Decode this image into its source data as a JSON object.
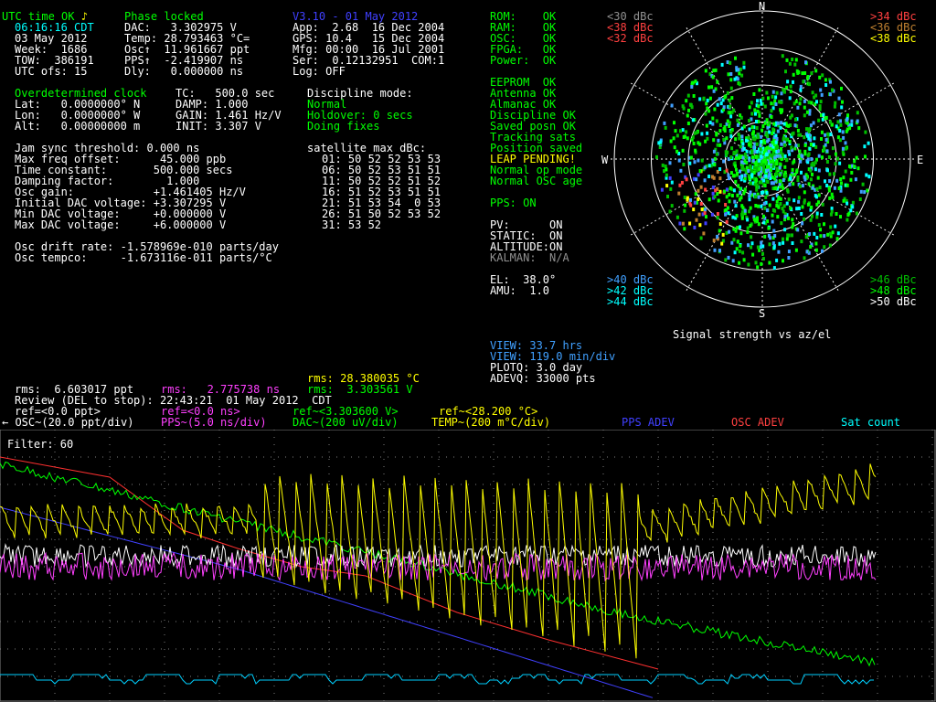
{
  "status": {
    "utc_ok": "UTC time OK",
    "note_icon": "♪",
    "phase": "Phase locked",
    "version": "V3.10 - 01 May 2012",
    "time": "06:16:16 CDT",
    "date": "03 May 2012",
    "week": "Week:  1686",
    "tow": "TOW:  386191",
    "utc_ofs": "UTC ofs: 15"
  },
  "col2": {
    "dac": "DAC:   3.302975 V",
    "temp": "Temp: 28.793463 °C=",
    "osc": "Osc↑  11.961667 ppt",
    "pps": "PPS↑  -2.419907 ns",
    "dly": "Dly:   0.000000 ns"
  },
  "col3": {
    "app": "App:  2.68  16 Dec 2004",
    "gps": "GPS: 10.4   15 Dec 2004",
    "mfg": "Mfg: 00:00  16 Jul 2001",
    "ser": "Ser:  0.12132951  COM:1",
    "log": "Log: OFF"
  },
  "health": {
    "rom": "ROM:    OK",
    "ram": "RAM:    OK",
    "osc": "OSC:    OK",
    "fpga": "FPGA:   OK",
    "power": "Power:  OK",
    "eeprom": "EEPROM  OK",
    "antenna": "Antenna OK",
    "almanac": "Almanac OK",
    "discipline": "Discipline OK",
    "saved_posn": "Saved posn OK",
    "tracking": "Tracking sats",
    "position_saved": "Position saved",
    "leap": "LEAP PENDING!",
    "normal_op": "Normal op mode",
    "normal_osc": "Normal OSC age",
    "pps_on": "PPS: ON",
    "pv": "PV:      ON",
    "static": "STATIC:  ON",
    "altitude": "ALTITUDE:ON",
    "kalman": "KALMAN:  N/A",
    "el": "EL:  38.0°",
    "amu": "AMU:  1.0"
  },
  "position": {
    "header": "Overdetermined clock",
    "lat": "Lat:   0.0000000° N",
    "lon": "Lon:   0.0000000° W",
    "alt": "Alt:   0.00000000 m",
    "tc": "TC:   500.0 sec",
    "damp": "DAMP: 1.000",
    "gain": "GAIN: 1.461 Hz/V",
    "init": "INIT: 3.307 V"
  },
  "discipline": {
    "header": "Discipline mode:",
    "normal": "Normal",
    "holdover": "Holdover: 0 secs",
    "fixes": "Doing fixes"
  },
  "params": [
    "Jam sync threshold: 0.000 ns",
    "Max freq offset:      45.000 ppb",
    "Time constant:       500.000 secs",
    "Damping factor:        1.000",
    "Osc gain:            +1.461405 Hz/V",
    "Initial DAC voltage: +3.307295 V",
    "Min DAC voltage:     +0.000000 V",
    "Max DAC voltage:     +6.000000 V"
  ],
  "drift": {
    "rate": "Osc drift rate: -1.578969e-010 parts/day",
    "tempco": "Osc tempco:     -1.673116e-011 parts/°C"
  },
  "sat_table": {
    "header": "satellite max dBc:",
    "rows": [
      "01: 50 52 52 53 53",
      "06: 50 52 53 51 51",
      "11: 50 52 52 51 52",
      "16: 51 52 53 51 51",
      "21: 51 53 54  0 53",
      "26: 51 50 52 53 52",
      "31: 53 52"
    ]
  },
  "polar": {
    "title": "Signal strength vs az/el",
    "n": "N",
    "s": "S",
    "e": "E",
    "w": "W",
    "legend_tl": [
      "<30 dBc",
      "<38 dBc",
      "<32 dBc"
    ],
    "legend_tr": [
      ">34 dBc",
      "<36 dBc",
      "<38 dBc"
    ],
    "legend_bl": [
      ">40 dBc",
      ">42 dBc",
      ">44 dBc"
    ],
    "legend_br": [
      ">46 dBc",
      ">48 dBc",
      ">50 dBc"
    ]
  },
  "view": {
    "hrs": "VIEW: 33.7 hrs",
    "min": "VIEW: 119.0 min/div",
    "plotq": "PLOTQ: 3.0 day",
    "adevq": "ADEVQ: 33000 pts"
  },
  "rms": {
    "temp": "rms: 28.380035 °C",
    "ppt": "rms:  6.603017 ppt",
    "ns": "rms:   2.775738 ns",
    "v": "rms:  3.303561 V"
  },
  "review": "Review (DEL to stop): 22:43:21  01 May 2012  CDT",
  "refs": {
    "osc": "ref=<0.0 ppt>",
    "pps": "ref=<0.0 ns>",
    "dac": "ref~<3.303600 V>",
    "temp": "ref~<28.200 °C>"
  },
  "legend": {
    "osc": "← OSC~(20.0 ppt/div)",
    "pps": "PPS~(5.0 ns/div)",
    "dac": "DAC~(200 uV/div)",
    "temp": "TEMP~(200 m°C/div)",
    "pps_adev": "PPS ADEV",
    "osc_adev": "OSC ADEV",
    "sat_count": "Sat count"
  },
  "filter": "Filter: 60",
  "colors": {
    "osc": "#ffffff",
    "pps": "#ff40ff",
    "dac": "#00ff00",
    "temp": "#ffff00",
    "pps_adev": "#4040ff",
    "osc_adev": "#ff3030",
    "sat": "#00d0ff"
  }
}
